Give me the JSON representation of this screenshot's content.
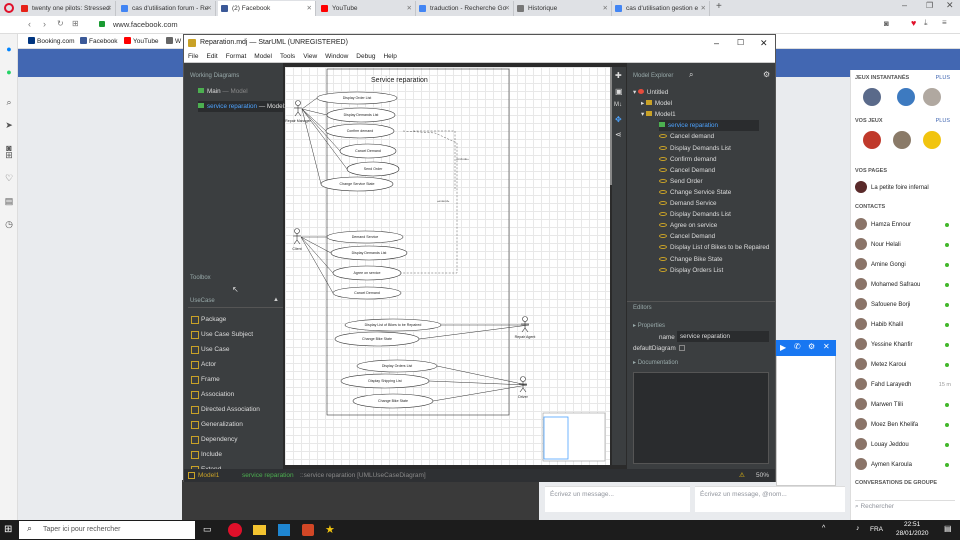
{
  "tabs": [
    {
      "label": "twenty one pilots: Stressed",
      "color": "#e62117"
    },
    {
      "label": "cas d'utilisation forum - Re",
      "color": "#4285f4"
    },
    {
      "label": "(2) Facebook",
      "color": "#3b5998"
    },
    {
      "label": "YouTube",
      "color": "#ff0000"
    },
    {
      "label": "traduction - Recherche Go",
      "color": "#4285f4"
    },
    {
      "label": "Historique",
      "color": "#777777"
    },
    {
      "label": "cas d'utilisation gestion e",
      "color": "#4285f4"
    }
  ],
  "address": "www.facebook.com",
  "bookmarks": [
    "Booking.com",
    "Facebook",
    "YouTube",
    "W"
  ],
  "app": {
    "title": "Reparation.mdj — StarUML (UNREGISTERED)",
    "menus": [
      "File",
      "Edit",
      "Format",
      "Model",
      "Tools",
      "View",
      "Window",
      "Debug",
      "Help"
    ],
    "working_diagrams_label": "Working Diagrams",
    "working_diagrams": [
      {
        "name": "Main",
        "owner": "— Model"
      },
      {
        "name": "service reparation",
        "owner": "— Model1"
      }
    ],
    "toolbox_label": "Toolbox",
    "usecase_label": "UseCase",
    "tools": [
      "Package",
      "Use Case Subject",
      "Use Case",
      "Actor",
      "Frame",
      "Association",
      "Directed Association",
      "Generalization",
      "Dependency",
      "Include",
      "Extend"
    ],
    "diagram": {
      "title": "Service reparation",
      "actors": [
        "Repair Manager",
        "Client",
        "Repair Agent",
        "Driver"
      ],
      "usecases": [
        "Display Order List",
        "Display Demands List",
        "Confirm demand",
        "Cancel Demand",
        "Send Order",
        "Change Service State",
        "Demand Service",
        "Display Demands List",
        "Agree on service",
        "Cancel Demand",
        "Display List of Bikes to be Repaired",
        "Change Bike State",
        "Display Orders List",
        "Display Shipping List",
        "Change Bike State"
      ],
      "include_label": "«include»",
      "extend_label": "«extend»"
    },
    "explorer_label": "Model Explorer",
    "tree": [
      {
        "label": "Untitled",
        "kind": "root"
      },
      {
        "label": "Model",
        "kind": "pkg"
      },
      {
        "label": "Model1",
        "kind": "pkg"
      },
      {
        "label": "service reparation",
        "kind": "diagram"
      },
      {
        "label": "Cancel demand",
        "kind": "uc"
      },
      {
        "label": "Display Demands List",
        "kind": "uc"
      },
      {
        "label": "Confirm demand",
        "kind": "uc"
      },
      {
        "label": "Cancel Demand",
        "kind": "uc"
      },
      {
        "label": "Send Order",
        "kind": "uc"
      },
      {
        "label": "Change Service State",
        "kind": "uc"
      },
      {
        "label": "Demand Service",
        "kind": "uc"
      },
      {
        "label": "Display Demands List",
        "kind": "uc"
      },
      {
        "label": "Agree on service",
        "kind": "uc"
      },
      {
        "label": "Cancel Demand",
        "kind": "uc"
      },
      {
        "label": "Display List of Bikes to be Repaired",
        "kind": "uc"
      },
      {
        "label": "Change Bike State",
        "kind": "uc"
      },
      {
        "label": "Display Orders List",
        "kind": "uc"
      }
    ],
    "editors_label": "Editors",
    "properties_label": "Properties",
    "prop_name_label": "name",
    "prop_name_value": "service reparation",
    "prop_default_label": "defaultDiagram",
    "documentation_label": "Documentation",
    "status_model": "Model1",
    "status_path": "::service reparation [UMLUseCaseDiagram]",
    "zoom": "50%"
  },
  "fb": {
    "stories_label": "JEUX INSTANTANÉS",
    "more": "PLUS",
    "games_label": "VOS JEUX",
    "pages_label": "VOS PAGES",
    "page_name": "La petite foire infernal",
    "contacts_label": "CONTACTS",
    "contacts": [
      {
        "name": "Hamza Ennour",
        "ago": ""
      },
      {
        "name": "Nour Helali",
        "ago": ""
      },
      {
        "name": "Amine Gongi",
        "ago": ""
      },
      {
        "name": "Mohamed Safraou",
        "ago": ""
      },
      {
        "name": "Safouene Borji",
        "ago": ""
      },
      {
        "name": "Habib Khalil",
        "ago": ""
      },
      {
        "name": "Yessine Khanfir",
        "ago": ""
      },
      {
        "name": "Metez Karoui",
        "ago": ""
      },
      {
        "name": "Fahd Larayedh",
        "ago": "15 m"
      },
      {
        "name": "Marwen Tlili",
        "ago": ""
      },
      {
        "name": "Moez Ben Khelifa",
        "ago": ""
      },
      {
        "name": "Louay Jeddou",
        "ago": ""
      },
      {
        "name": "Aymen Karoula",
        "ago": ""
      }
    ],
    "group_label": "CONVERSATIONS DE GROUPE",
    "search_placeholder": "Rechercher",
    "compose1": "Écrivez un message...",
    "compose2": "Écrivez un message, @nom..."
  },
  "taskbar": {
    "search": "Taper ici pour rechercher",
    "lang": "FRA",
    "time": "22:51",
    "date": "28/01/2020"
  }
}
